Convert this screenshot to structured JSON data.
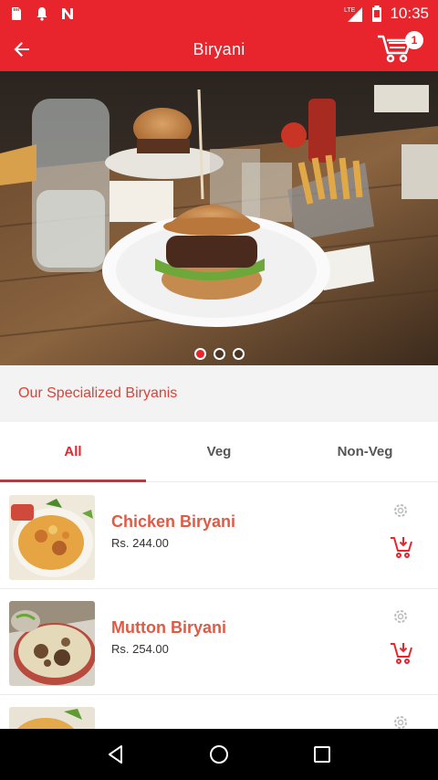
{
  "status_bar": {
    "time": "10:35",
    "network": "LTE",
    "left_icons": [
      "sd-card-icon",
      "notification-bell-icon",
      "app-n-icon"
    ],
    "right_icons": [
      "lte-signal-icon",
      "battery-icon"
    ]
  },
  "app_bar": {
    "title": "Biryani",
    "cart_count": "1",
    "icons": [
      "back-arrow-icon",
      "shopping-cart-icon"
    ]
  },
  "banner": {
    "slides": 3,
    "active_slide": 0
  },
  "section": {
    "title": "Our Specialized Biryanis"
  },
  "tabs": [
    {
      "label": "All",
      "active": true
    },
    {
      "label": "Veg",
      "active": false
    },
    {
      "label": "Non-Veg",
      "active": false
    }
  ],
  "items": [
    {
      "name": "Chicken Biryani",
      "price": "Rs. 244.00"
    },
    {
      "name": "Mutton Biryani",
      "price": "Rs. 254.00"
    },
    {
      "name": "",
      "price": ""
    }
  ],
  "colors": {
    "primary": "#e8242c",
    "item_name": "#e05a44",
    "section_bg": "#f4f3f3"
  },
  "nav": {
    "icons": [
      "back-triangle-icon",
      "home-circle-icon",
      "recents-square-icon"
    ]
  }
}
